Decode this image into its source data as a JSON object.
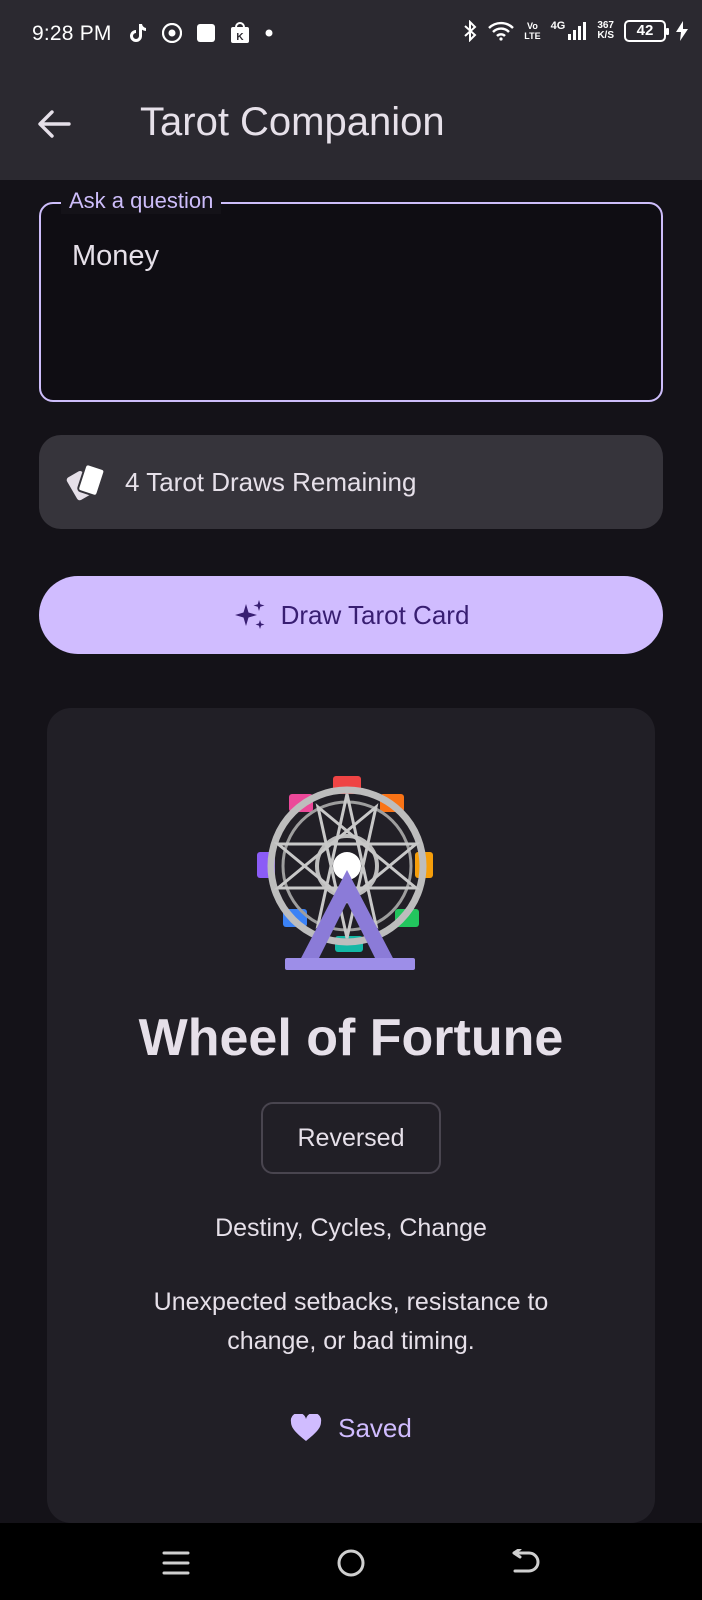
{
  "status_bar": {
    "time": "9:28 PM",
    "left_icons": [
      "tiktok-icon",
      "chrome-icon",
      "app-square-icon",
      "shop-bag-icon",
      "dot-icon"
    ],
    "volte_top": "Vo",
    "volte_bottom": "LTE",
    "network": "4G",
    "speed_top": "367",
    "speed_bottom": "K/S",
    "battery": "42"
  },
  "app_bar": {
    "title": "Tarot Companion",
    "back_icon": "arrow-back-icon"
  },
  "question": {
    "label": "Ask a question",
    "value": "Money"
  },
  "draws": {
    "text": "4 Tarot Draws Remaining",
    "icon": "cards-icon"
  },
  "draw_button": {
    "label": "Draw Tarot Card",
    "icon": "sparkle-icon"
  },
  "card": {
    "icon": "ferris-wheel-icon",
    "title": "Wheel of Fortune",
    "orientation": "Reversed",
    "keywords": "Destiny, Cycles, Change",
    "meaning": "Unexpected setbacks, resistance to change, or bad timing.",
    "save_label": "Saved",
    "save_icon": "heart-icon"
  },
  "nav_bar": {
    "items": [
      "menu-icon",
      "home-icon",
      "back-icon"
    ]
  },
  "colors": {
    "primary": "#d0bcff",
    "outline_focus": "#cdbdfa",
    "surface": "#141218",
    "card": "#211f26",
    "chip": "#36343b"
  }
}
